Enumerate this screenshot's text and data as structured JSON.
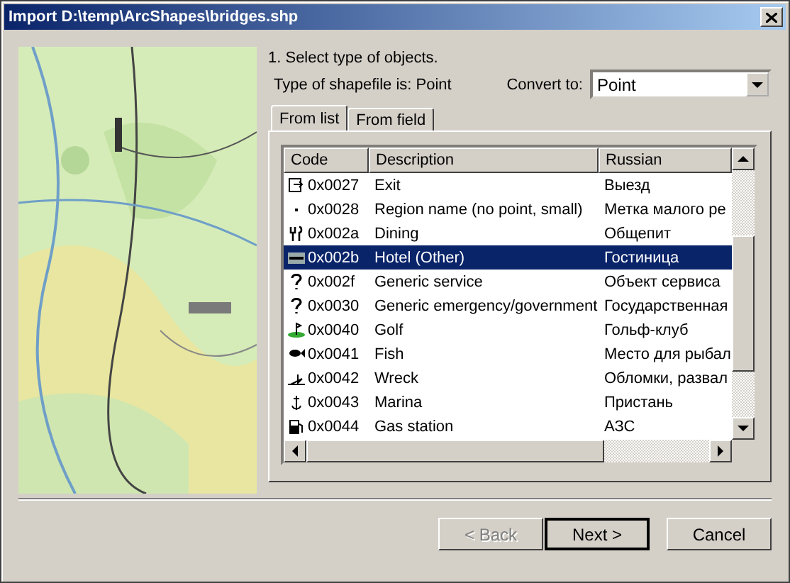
{
  "window": {
    "title": "Import D:\\temp\\ArcShapes\\bridges.shp"
  },
  "step": "1. Select type of objects.",
  "shapefile_type": "Type of shapefile is: Point",
  "convert": {
    "label": "Convert to:",
    "value": "Point"
  },
  "tabs": [
    {
      "label": "From list",
      "selected": true
    },
    {
      "label": "From field",
      "selected": false
    }
  ],
  "table": {
    "columns": [
      "Code",
      "Description",
      "Russian"
    ],
    "rows": [
      {
        "code": "0x0027",
        "description": "Exit",
        "russian": "Выезд",
        "selected": false
      },
      {
        "code": "0x0028",
        "description": "Region name (no point, small)",
        "russian": "Метка малого ре",
        "selected": false
      },
      {
        "code": "0x002a",
        "description": "Dining",
        "russian": "Общепит",
        "selected": false
      },
      {
        "code": "0x002b",
        "description": "Hotel (Other)",
        "russian": "Гостиница",
        "selected": true
      },
      {
        "code": "0x002f",
        "description": "Generic service",
        "russian": "Объект сервиса",
        "selected": false
      },
      {
        "code": "0x0030",
        "description": "Generic emergency/government",
        "russian": "Государственная",
        "selected": false
      },
      {
        "code": "0x0040",
        "description": "Golf",
        "russian": "Гольф-клуб",
        "selected": false
      },
      {
        "code": "0x0041",
        "description": "Fish",
        "russian": "Место для рыбал",
        "selected": false
      },
      {
        "code": "0x0042",
        "description": "Wreck",
        "russian": "Обломки, развал",
        "selected": false
      },
      {
        "code": "0x0043",
        "description": "Marina",
        "russian": "Пристань",
        "selected": false
      },
      {
        "code": "0x0044",
        "description": "Gas station",
        "russian": "АЗС",
        "selected": false
      }
    ]
  },
  "buttons": [
    {
      "label": "< Back",
      "disabled": true,
      "default": false
    },
    {
      "label": "Next >",
      "disabled": false,
      "default": true
    },
    {
      "label": "Cancel",
      "disabled": false,
      "default": false
    }
  ]
}
